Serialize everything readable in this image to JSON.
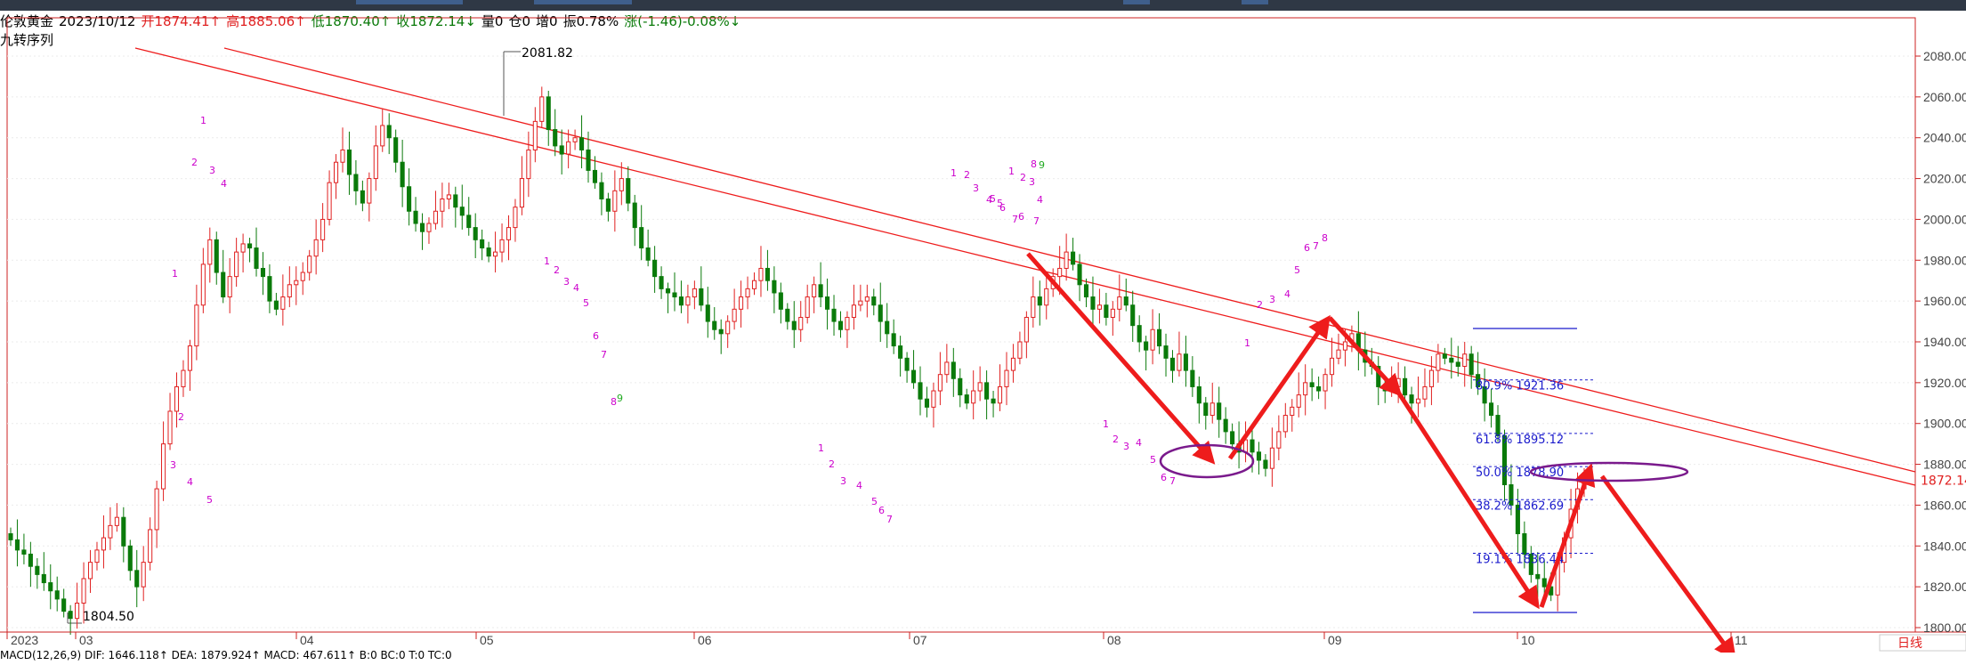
{
  "header": {
    "name": "伦敦黄金",
    "date": "2023/10/12",
    "open": "开1874.41↑",
    "high": "高1885.06↑",
    "low": "低1870.40↑",
    "close": "收1872.14↓",
    "volume": "量0",
    "oi": "仓0",
    "add": "增0",
    "amplitude": "振0.78%",
    "change": "涨(-1.46)-0.08%↓"
  },
  "indicator_label": "九转序列",
  "period_label": "日线",
  "macd_label": "MACD(12,26,9)  DIF: 1646.118↑  DEA: 1879.924↑  MACD: 467.611↑  B:0  BC:0  T:0  TC:0",
  "price_label": "1872.14",
  "colors": {
    "up": "#e02020",
    "down": "#0a7a0a",
    "trend": "#ee1c1c",
    "fib": "#1a1acc",
    "ellipse": "#7a1a8c",
    "td": "#cc00cc",
    "td9": "#22aa22"
  },
  "chart_data": {
    "type": "candlestick",
    "ylim": [
      1800,
      2090
    ],
    "y_ticks": [
      1800,
      1820,
      1840,
      1860,
      1880,
      1900,
      1920,
      1940,
      1960,
      1980,
      2000,
      2020,
      2040,
      2060,
      2080
    ],
    "x_labels": [
      "2023",
      "03",
      "04",
      "05",
      "06",
      "07",
      "08",
      "09",
      "10",
      "11"
    ],
    "annotations": {
      "high": "2081.82",
      "low": "1804.50"
    },
    "fib_levels": [
      {
        "label": "80.9%  1921.36",
        "value": 1921.36
      },
      {
        "label": "61.8%  1895.12",
        "value": 1895.12
      },
      {
        "label": "50.0%  1878.90",
        "value": 1878.9
      },
      {
        "label": "38.2%  1862.69",
        "value": 1862.69
      },
      {
        "label": "19.1%  1836.44",
        "value": 1836.44
      }
    ],
    "close_series": [
      1843,
      1838,
      1836,
      1830,
      1826,
      1822,
      1818,
      1814,
      1808,
      1804.5,
      1812,
      1824,
      1832,
      1838,
      1844,
      1850,
      1854,
      1840,
      1828,
      1820,
      1832,
      1848,
      1868,
      1890,
      1906,
      1918,
      1926,
      1938,
      1958,
      1978,
      1990,
      1974,
      1962,
      1972,
      1984,
      1988,
      1986,
      1976,
      1972,
      1960,
      1956,
      1962,
      1968,
      1970,
      1974,
      1982,
      1990,
      2000,
      2018,
      2028,
      2034,
      2022,
      2014,
      2008,
      2020,
      2036,
      2046,
      2040,
      2028,
      2016,
      2004,
      1998,
      1994,
      1998,
      2004,
      2010,
      2012,
      2006,
      2002,
      1996,
      1990,
      1986,
      1982,
      1984,
      1990,
      1996,
      2006,
      2020,
      2034,
      2048,
      2060,
      2044,
      2036,
      2032,
      2038,
      2040,
      2034,
      2024,
      2018,
      2010,
      2004,
      2014,
      2020,
      2008,
      1996,
      1986,
      1980,
      1972,
      1966,
      1964,
      1962,
      1958,
      1962,
      1966,
      1958,
      1950,
      1946,
      1944,
      1950,
      1956,
      1962,
      1966,
      1970,
      1976,
      1970,
      1964,
      1956,
      1950,
      1946,
      1952,
      1962,
      1968,
      1962,
      1956,
      1950,
      1946,
      1952,
      1958,
      1960,
      1962,
      1958,
      1950,
      1944,
      1938,
      1932,
      1926,
      1920,
      1912,
      1908,
      1916,
      1924,
      1930,
      1922,
      1914,
      1910,
      1916,
      1920,
      1912,
      1910,
      1918,
      1926,
      1932,
      1940,
      1952,
      1962,
      1958,
      1966,
      1972,
      1976,
      1984,
      1978,
      1968,
      1962,
      1956,
      1958,
      1952,
      1956,
      1962,
      1958,
      1948,
      1940,
      1936,
      1946,
      1938,
      1932,
      1926,
      1934,
      1926,
      1918,
      1910,
      1904,
      1910,
      1902,
      1896,
      1890,
      1886,
      1892,
      1886,
      1882,
      1878,
      1888,
      1896,
      1904,
      1908,
      1914,
      1920,
      1918,
      1916,
      1924,
      1932,
      1936,
      1940,
      1944,
      1936,
      1930,
      1928,
      1918,
      1916,
      1918,
      1922,
      1914,
      1910,
      1912,
      1918,
      1926,
      1934,
      1932,
      1930,
      1928,
      1934,
      1924,
      1918,
      1910,
      1904,
      1894,
      1870,
      1860,
      1846,
      1836,
      1826,
      1824,
      1820,
      1816,
      1832,
      1844,
      1858,
      1868,
      1872.14
    ]
  }
}
